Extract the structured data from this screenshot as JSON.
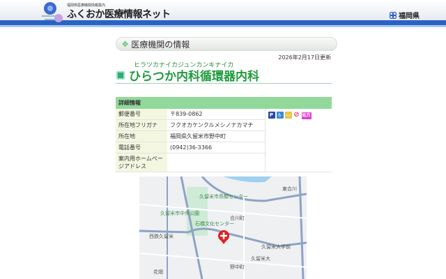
{
  "header": {
    "subtitle": "福岡県医療機関情報案内",
    "title": "ふくおか医療情報ネット",
    "prefecture": "福岡県"
  },
  "section": {
    "title": "医療機関の情報"
  },
  "facility": {
    "updated": "2026年2月17日更新",
    "kana": "ヒラツカナイカジュンカンキナイカ",
    "name": "ひらつか内科循環器内科"
  },
  "details": {
    "header": "詳細情報",
    "rows": [
      {
        "label": "郵便番号",
        "value": "〒839-0862"
      },
      {
        "label": "所在地フリガナ",
        "value": "フクオカケンクルメシノナカマチ"
      },
      {
        "label": "所在地",
        "value": "福岡県久留米市野中町"
      },
      {
        "label": "電話番号",
        "value": "(0942)36-3366"
      },
      {
        "label": "案内用ホームページアドレス",
        "value": ""
      }
    ],
    "icons": [
      {
        "name": "parking",
        "glyph": "P",
        "color": "#2a48a8"
      },
      {
        "name": "wheelchair",
        "glyph": "♿",
        "color": "#3a8ad8"
      },
      {
        "name": "card",
        "glyph": "▭",
        "color": "#e8c640"
      },
      {
        "name": "no-smoking",
        "glyph": "⊘",
        "color": "#e04070"
      },
      {
        "name": "prescription",
        "glyph": "処方",
        "color": "#e040d0"
      }
    ]
  },
  "map": {
    "labels": [
      "久留米市鳥類センター",
      "久留米市中央公園",
      "合川町",
      "西鉄久留米",
      "石橋文化センター",
      "久留米大学前",
      "久留米大",
      "野中町",
      "花畑",
      "東合川"
    ]
  }
}
